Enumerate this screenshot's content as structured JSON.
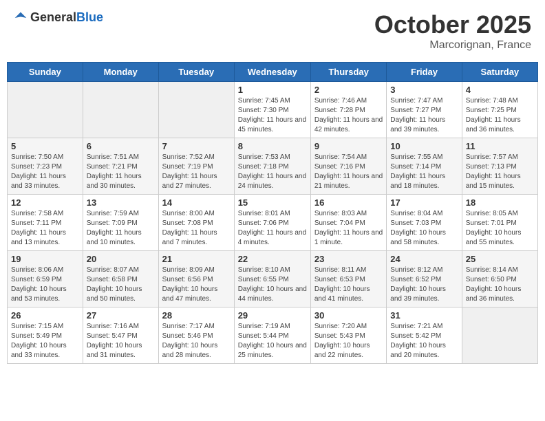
{
  "header": {
    "logo_general": "General",
    "logo_blue": "Blue",
    "month": "October 2025",
    "location": "Marcorignan, France"
  },
  "weekdays": [
    "Sunday",
    "Monday",
    "Tuesday",
    "Wednesday",
    "Thursday",
    "Friday",
    "Saturday"
  ],
  "weeks": [
    [
      {
        "day": "",
        "info": ""
      },
      {
        "day": "",
        "info": ""
      },
      {
        "day": "",
        "info": ""
      },
      {
        "day": "1",
        "info": "Sunrise: 7:45 AM\nSunset: 7:30 PM\nDaylight: 11 hours and 45 minutes."
      },
      {
        "day": "2",
        "info": "Sunrise: 7:46 AM\nSunset: 7:28 PM\nDaylight: 11 hours and 42 minutes."
      },
      {
        "day": "3",
        "info": "Sunrise: 7:47 AM\nSunset: 7:27 PM\nDaylight: 11 hours and 39 minutes."
      },
      {
        "day": "4",
        "info": "Sunrise: 7:48 AM\nSunset: 7:25 PM\nDaylight: 11 hours and 36 minutes."
      }
    ],
    [
      {
        "day": "5",
        "info": "Sunrise: 7:50 AM\nSunset: 7:23 PM\nDaylight: 11 hours and 33 minutes."
      },
      {
        "day": "6",
        "info": "Sunrise: 7:51 AM\nSunset: 7:21 PM\nDaylight: 11 hours and 30 minutes."
      },
      {
        "day": "7",
        "info": "Sunrise: 7:52 AM\nSunset: 7:19 PM\nDaylight: 11 hours and 27 minutes."
      },
      {
        "day": "8",
        "info": "Sunrise: 7:53 AM\nSunset: 7:18 PM\nDaylight: 11 hours and 24 minutes."
      },
      {
        "day": "9",
        "info": "Sunrise: 7:54 AM\nSunset: 7:16 PM\nDaylight: 11 hours and 21 minutes."
      },
      {
        "day": "10",
        "info": "Sunrise: 7:55 AM\nSunset: 7:14 PM\nDaylight: 11 hours and 18 minutes."
      },
      {
        "day": "11",
        "info": "Sunrise: 7:57 AM\nSunset: 7:13 PM\nDaylight: 11 hours and 15 minutes."
      }
    ],
    [
      {
        "day": "12",
        "info": "Sunrise: 7:58 AM\nSunset: 7:11 PM\nDaylight: 11 hours and 13 minutes."
      },
      {
        "day": "13",
        "info": "Sunrise: 7:59 AM\nSunset: 7:09 PM\nDaylight: 11 hours and 10 minutes."
      },
      {
        "day": "14",
        "info": "Sunrise: 8:00 AM\nSunset: 7:08 PM\nDaylight: 11 hours and 7 minutes."
      },
      {
        "day": "15",
        "info": "Sunrise: 8:01 AM\nSunset: 7:06 PM\nDaylight: 11 hours and 4 minutes."
      },
      {
        "day": "16",
        "info": "Sunrise: 8:03 AM\nSunset: 7:04 PM\nDaylight: 11 hours and 1 minute."
      },
      {
        "day": "17",
        "info": "Sunrise: 8:04 AM\nSunset: 7:03 PM\nDaylight: 10 hours and 58 minutes."
      },
      {
        "day": "18",
        "info": "Sunrise: 8:05 AM\nSunset: 7:01 PM\nDaylight: 10 hours and 55 minutes."
      }
    ],
    [
      {
        "day": "19",
        "info": "Sunrise: 8:06 AM\nSunset: 6:59 PM\nDaylight: 10 hours and 53 minutes."
      },
      {
        "day": "20",
        "info": "Sunrise: 8:07 AM\nSunset: 6:58 PM\nDaylight: 10 hours and 50 minutes."
      },
      {
        "day": "21",
        "info": "Sunrise: 8:09 AM\nSunset: 6:56 PM\nDaylight: 10 hours and 47 minutes."
      },
      {
        "day": "22",
        "info": "Sunrise: 8:10 AM\nSunset: 6:55 PM\nDaylight: 10 hours and 44 minutes."
      },
      {
        "day": "23",
        "info": "Sunrise: 8:11 AM\nSunset: 6:53 PM\nDaylight: 10 hours and 41 minutes."
      },
      {
        "day": "24",
        "info": "Sunrise: 8:12 AM\nSunset: 6:52 PM\nDaylight: 10 hours and 39 minutes."
      },
      {
        "day": "25",
        "info": "Sunrise: 8:14 AM\nSunset: 6:50 PM\nDaylight: 10 hours and 36 minutes."
      }
    ],
    [
      {
        "day": "26",
        "info": "Sunrise: 7:15 AM\nSunset: 5:49 PM\nDaylight: 10 hours and 33 minutes."
      },
      {
        "day": "27",
        "info": "Sunrise: 7:16 AM\nSunset: 5:47 PM\nDaylight: 10 hours and 31 minutes."
      },
      {
        "day": "28",
        "info": "Sunrise: 7:17 AM\nSunset: 5:46 PM\nDaylight: 10 hours and 28 minutes."
      },
      {
        "day": "29",
        "info": "Sunrise: 7:19 AM\nSunset: 5:44 PM\nDaylight: 10 hours and 25 minutes."
      },
      {
        "day": "30",
        "info": "Sunrise: 7:20 AM\nSunset: 5:43 PM\nDaylight: 10 hours and 22 minutes."
      },
      {
        "day": "31",
        "info": "Sunrise: 7:21 AM\nSunset: 5:42 PM\nDaylight: 10 hours and 20 minutes."
      },
      {
        "day": "",
        "info": ""
      }
    ]
  ]
}
